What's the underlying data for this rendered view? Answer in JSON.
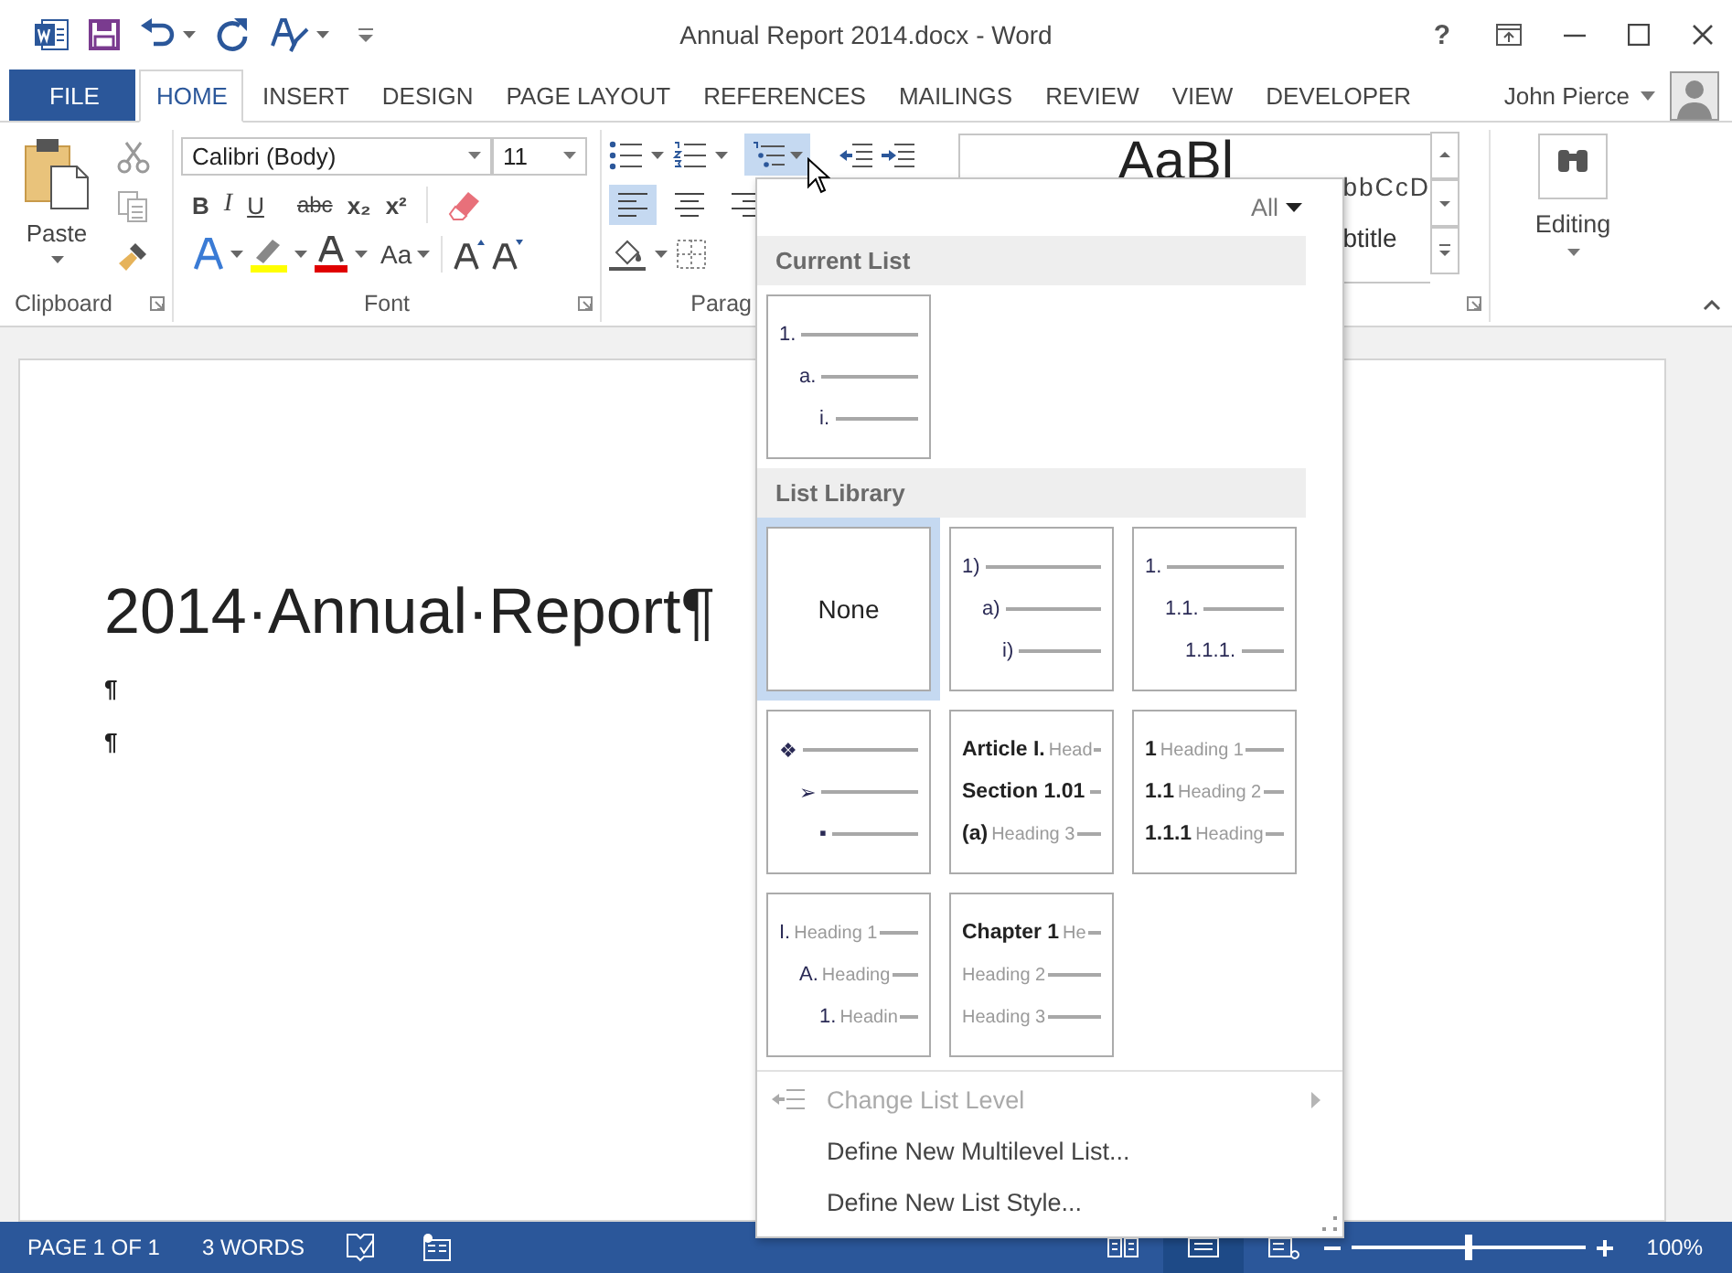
{
  "title_bar": {
    "title": "Annual Report 2014.docx - Word",
    "help": "?"
  },
  "tabs": [
    {
      "label": "FILE",
      "kind": "file",
      "selected": false
    },
    {
      "label": "HOME",
      "kind": "tab",
      "selected": true
    },
    {
      "label": "INSERT",
      "kind": "tab",
      "selected": false
    },
    {
      "label": "DESIGN",
      "kind": "tab",
      "selected": false
    },
    {
      "label": "PAGE LAYOUT",
      "kind": "tab",
      "selected": false
    },
    {
      "label": "REFERENCES",
      "kind": "tab",
      "selected": false
    },
    {
      "label": "MAILINGS",
      "kind": "tab",
      "selected": false
    },
    {
      "label": "REVIEW",
      "kind": "tab",
      "selected": false
    },
    {
      "label": "VIEW",
      "kind": "tab",
      "selected": false
    },
    {
      "label": "DEVELOPER",
      "kind": "tab",
      "selected": false
    }
  ],
  "user": {
    "name": "John Pierce"
  },
  "ribbon": {
    "clipboard": {
      "paste": "Paste",
      "label": "Clipboard"
    },
    "font": {
      "name": "Calibri (Body)",
      "size": "11",
      "format_buttons": [
        "B",
        "I",
        "U",
        "abc",
        "x₂",
        "x²"
      ],
      "case_button": "Aa",
      "label": "Font"
    },
    "paragraph": {
      "label": "Parag",
      "multilevel_open": true,
      "alignments": [
        {
          "selected": true
        },
        {
          "selected": false
        },
        {
          "selected": false
        }
      ]
    },
    "styles": {
      "samples": [
        "AaBl",
        "bbCcD"
      ],
      "style_name": "btitle"
    },
    "editing": {
      "label": "Editing"
    }
  },
  "document": {
    "heading": "2014·Annual·Report¶",
    "paragraphs": [
      "¶",
      "¶"
    ]
  },
  "multilevel_menu": {
    "filter": "All",
    "sections": [
      {
        "title": "Current List",
        "items": [
          {
            "kind": "outline",
            "selected": false,
            "levels": [
              {
                "marker": "1."
              },
              {
                "marker": "a."
              },
              {
                "marker": "i."
              }
            ]
          }
        ]
      },
      {
        "title": "List Library",
        "items": [
          {
            "kind": "none",
            "selected": true,
            "label": "None"
          },
          {
            "kind": "outline",
            "selected": false,
            "levels": [
              {
                "marker": "1)"
              },
              {
                "marker": "a)"
              },
              {
                "marker": "i)"
              }
            ]
          },
          {
            "kind": "outline",
            "selected": false,
            "levels": [
              {
                "marker": "1."
              },
              {
                "marker": "1.1."
              },
              {
                "marker": "1.1.1."
              }
            ]
          },
          {
            "kind": "outline",
            "selected": false,
            "levels": [
              {
                "marker": "❖"
              },
              {
                "marker": "➢"
              },
              {
                "marker": "▪"
              }
            ]
          },
          {
            "kind": "heading",
            "selected": false,
            "levels": [
              {
                "marker": "Article I.",
                "text": "Head"
              },
              {
                "marker": "Section 1.01"
              },
              {
                "marker": "(a)",
                "text": "Heading 3"
              }
            ]
          },
          {
            "kind": "heading",
            "selected": false,
            "levels": [
              {
                "marker": "1",
                "text": "Heading 1"
              },
              {
                "marker": "1.1",
                "text": "Heading 2"
              },
              {
                "marker": "1.1.1",
                "text": "Heading"
              }
            ]
          },
          {
            "kind": "outline",
            "selected": false,
            "levels": [
              {
                "marker": "I.",
                "text": "Heading 1"
              },
              {
                "marker": "A.",
                "text": "Heading"
              },
              {
                "marker": "1.",
                "text": "Headin"
              }
            ]
          },
          {
            "kind": "heading",
            "selected": false,
            "levels": [
              {
                "marker": "Chapter 1",
                "text": "He"
              },
              {
                "text": "Heading 2"
              },
              {
                "text": "Heading 3"
              }
            ]
          }
        ]
      }
    ],
    "commands": [
      {
        "label": "Change List Level",
        "disabled": true,
        "submenu": true
      },
      {
        "label": "Define New Multilevel List...",
        "disabled": false,
        "submenu": false
      },
      {
        "label": "Define New List Style...",
        "disabled": false,
        "submenu": false
      }
    ]
  },
  "status_bar": {
    "page": "PAGE 1 OF 1",
    "words": "3 WORDS",
    "views": [
      {
        "selected": false
      },
      {
        "selected": true
      },
      {
        "selected": false
      }
    ],
    "zoom": {
      "level": 0.5
    },
    "zoom_text": "100%"
  }
}
